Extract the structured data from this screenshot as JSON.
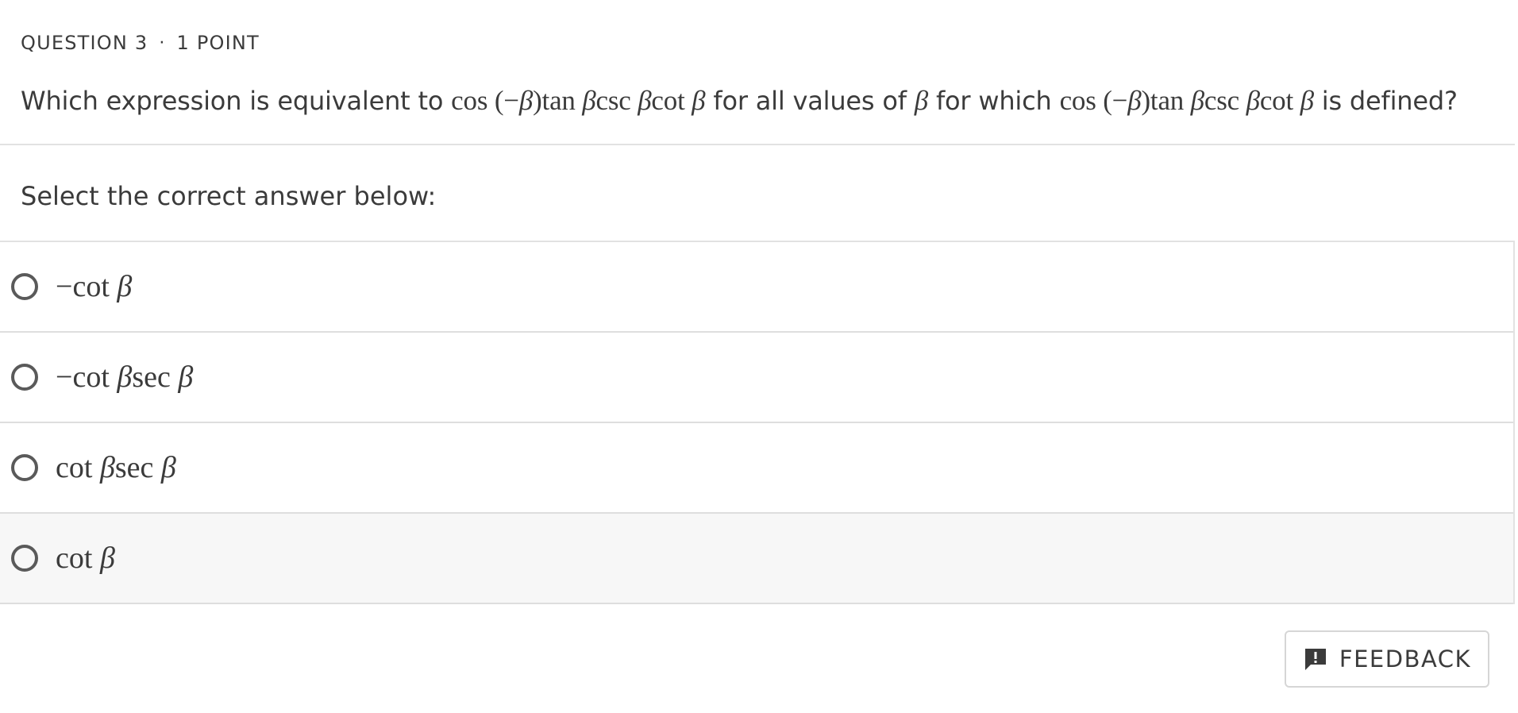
{
  "question": {
    "number_label": "QUESTION 3",
    "separator": "·",
    "points_label": "1 POINT",
    "text_prefix": "Which expression is equivalent to ",
    "expression": "cos (−β)tan βcsc βcot β",
    "text_middle_1": " for all values of ",
    "variable": "β",
    "text_middle_2": " for which ",
    "expression_repeat": "cos (−β)tan βcsc βcot β",
    "text_suffix": " is defined?"
  },
  "prompt": "Select the correct answer below:",
  "options": [
    {
      "label": "−cot β"
    },
    {
      "label": "−cot βsec β"
    },
    {
      "label": "cot βsec β"
    },
    {
      "label": "cot β"
    }
  ],
  "feedback": {
    "label": "FEEDBACK",
    "icon": "feedback-icon"
  }
}
